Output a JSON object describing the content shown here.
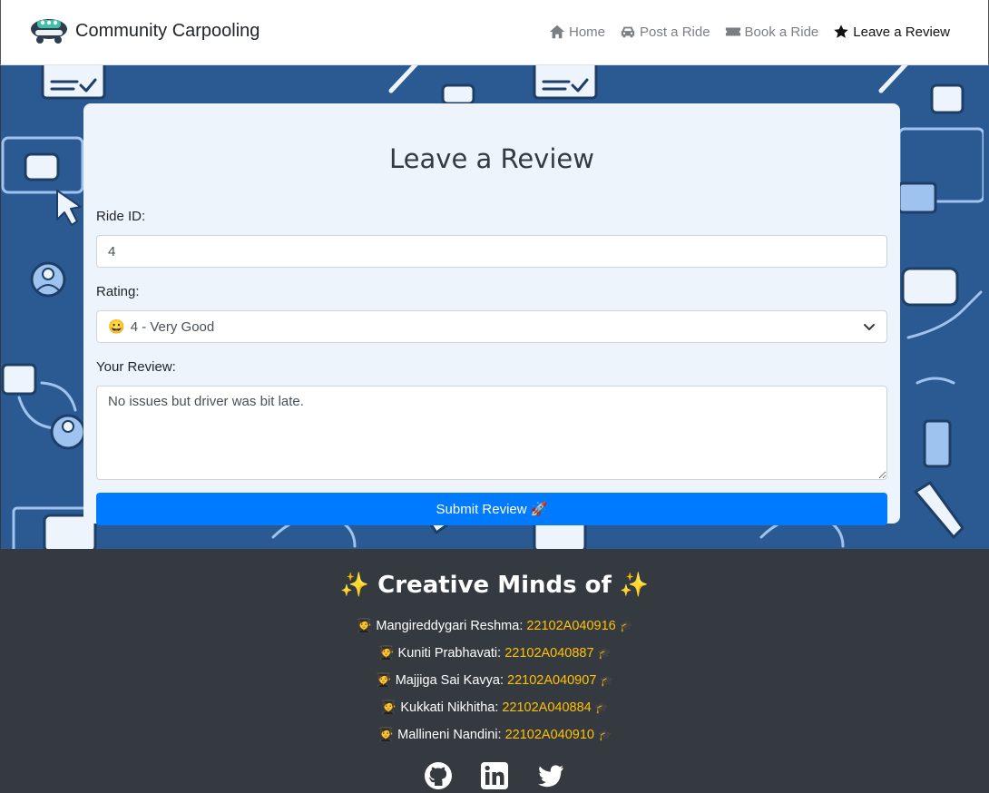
{
  "navbar": {
    "brand": "Community Carpooling",
    "links": [
      {
        "label": "Home",
        "icon": "home-icon",
        "active": false
      },
      {
        "label": "Post a Ride",
        "icon": "car-icon",
        "active": false
      },
      {
        "label": "Book a Ride",
        "icon": "ticket-icon",
        "active": false
      },
      {
        "label": "Leave a Review",
        "icon": "star-icon",
        "active": true
      }
    ]
  },
  "form": {
    "title": "Leave a Review",
    "ride_id_label": "Ride ID:",
    "ride_id_value": "4",
    "rating_label": "Rating:",
    "rating_emoji": "😀",
    "rating_value": "4 - Very Good",
    "review_label": "Your Review:",
    "review_value": "No issues but driver was bit late.",
    "submit_label": "Submit Review 🚀"
  },
  "footer": {
    "title_prefix": "✨",
    "title": "Creative Minds of",
    "title_suffix": "✨",
    "members": [
      {
        "name": "Mangireddygari Reshma:",
        "roll": "22102A040916"
      },
      {
        "name": "Kuniti Prabhavati:",
        "roll": "22102A040887"
      },
      {
        "name": "Majjiga Sai Kavya:",
        "roll": "22102A040907"
      },
      {
        "name": "Kukkati Nikhitha:",
        "roll": "22102A040884"
      },
      {
        "name": "Mallineni Nandini:",
        "roll": "22102A040910"
      }
    ],
    "member_icon": "🧑‍🎓",
    "cap_icon": "🎓",
    "socials": [
      "github-icon",
      "linkedin-icon",
      "twitter-icon"
    ]
  },
  "colors": {
    "primary": "#007bff",
    "pattern_bg": "#2b5a93",
    "footer_bg": "#343a40",
    "roll_color": "#ffc107"
  }
}
